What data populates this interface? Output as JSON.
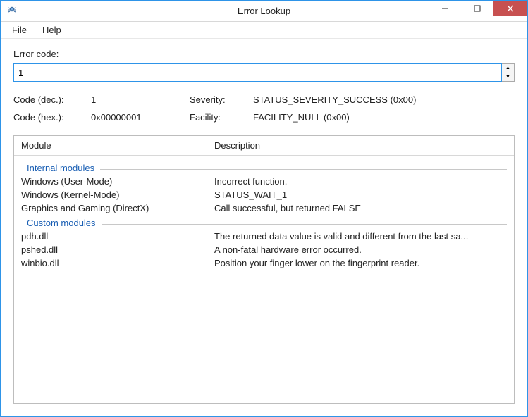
{
  "window": {
    "title": "Error Lookup"
  },
  "menu": {
    "file": "File",
    "help": "Help"
  },
  "labels": {
    "error_code": "Error code:",
    "code_dec": "Code (dec.):",
    "code_hex": "Code (hex.):",
    "severity": "Severity:",
    "facility": "Facility:"
  },
  "input": {
    "value": "1"
  },
  "info": {
    "code_dec": "1",
    "code_hex": "0x00000001",
    "severity": "STATUS_SEVERITY_SUCCESS (0x00)",
    "facility": "FACILITY_NULL (0x00)"
  },
  "table": {
    "headers": {
      "module": "Module",
      "description": "Description"
    },
    "groups": [
      {
        "title": "Internal modules",
        "rows": [
          {
            "module": "Windows (User-Mode)",
            "desc": "Incorrect function."
          },
          {
            "module": "Windows (Kernel-Mode)",
            "desc": "STATUS_WAIT_1"
          },
          {
            "module": "Graphics and Gaming (DirectX)",
            "desc": "Call successful, but returned FALSE"
          }
        ]
      },
      {
        "title": "Custom modules",
        "rows": [
          {
            "module": "pdh.dll",
            "desc": "The returned data value is valid and different from the last sa..."
          },
          {
            "module": "pshed.dll",
            "desc": "A non-fatal hardware error occurred."
          },
          {
            "module": "winbio.dll",
            "desc": "Position your finger lower on the fingerprint reader."
          }
        ]
      }
    ]
  }
}
